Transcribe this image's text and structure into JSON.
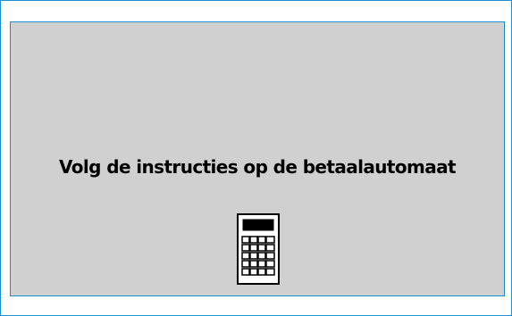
{
  "dialog": {
    "message": "Volg de instructies op de betaalautomaat",
    "icon": "payment-terminal-icon"
  },
  "colors": {
    "frame_border": "#1a8fd0",
    "panel_background": "#d0d0d0",
    "text": "#000000"
  }
}
